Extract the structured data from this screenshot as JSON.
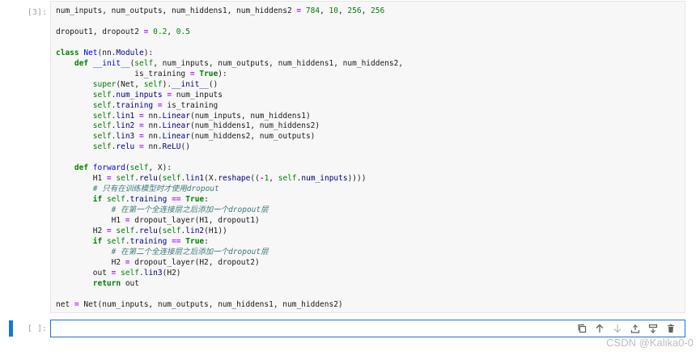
{
  "cell1": {
    "prompt": "[3]:",
    "code_lines": [
      "num_inputs, num_outputs, num_hiddens1, num_hiddens2 = 784, 10, 256, 256",
      "",
      "dropout1, dropout2 = 0.2, 0.5",
      "",
      "class Net(nn.Module):",
      "    def __init__(self, num_inputs, num_outputs, num_hiddens1, num_hiddens2,",
      "                 is_training = True):",
      "        super(Net, self).__init__()",
      "        self.num_inputs = num_inputs",
      "        self.training = is_training",
      "        self.lin1 = nn.Linear(num_inputs, num_hiddens1)",
      "        self.lin2 = nn.Linear(num_hiddens1, num_hiddens2)",
      "        self.lin3 = nn.Linear(num_hiddens2, num_outputs)",
      "        self.relu = nn.ReLU()",
      "",
      "    def forward(self, X):",
      "        H1 = self.relu(self.lin1(X.reshape((-1, self.num_inputs))))",
      "        # 只有在训练模型时才使用dropout",
      "        if self.training == True:",
      "            # 在第一个全连接层之后添加一个dropout层",
      "            H1 = dropout_layer(H1, dropout1)",
      "        H2 = self.relu(self.lin2(H1))",
      "        if self.training == True:",
      "            # 在第二个全连接层之后添加一个dropout层",
      "            H2 = dropout_layer(H2, dropout2)",
      "        out = self.lin3(H2)",
      "        return out",
      "",
      "net = Net(num_inputs, num_outputs, num_hiddens1, num_hiddens2)"
    ]
  },
  "cell2": {
    "prompt": "[ ]:"
  },
  "toolbar": {
    "icons": [
      "copy-icon",
      "move-up-icon",
      "move-down-icon",
      "insert-above-icon",
      "insert-below-icon",
      "delete-icon"
    ],
    "active_color": "#1976d2"
  },
  "watermark": "CSDN @Kalika0-0"
}
